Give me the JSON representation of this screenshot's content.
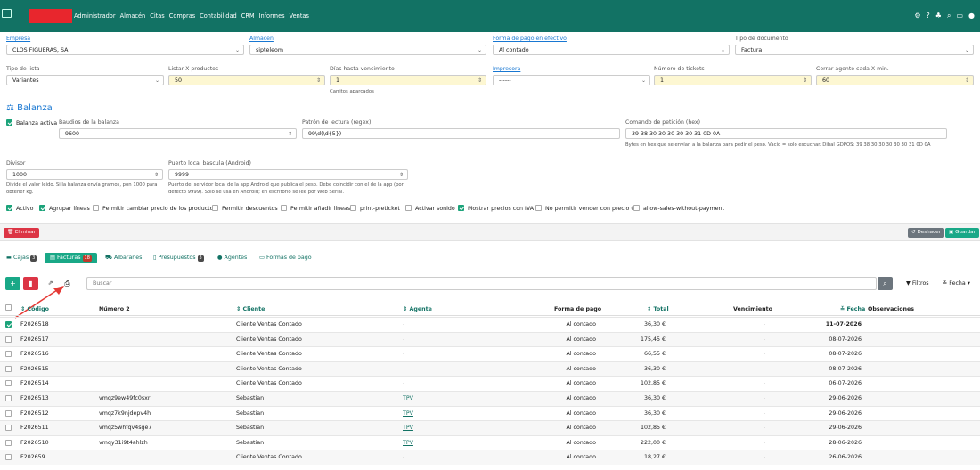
{
  "nav": {
    "menu": [
      "Administrador",
      "Almacén",
      "Citas",
      "Compras",
      "Contabilidad",
      "CRM",
      "Informes",
      "Ventas"
    ]
  },
  "form": {
    "empresa": {
      "label": "Empresa",
      "value": "CLOS FIGUERAS, SA"
    },
    "almacen": {
      "label": "Almacén",
      "value": "sipteleom"
    },
    "forma_pago": {
      "label": "Forma de pago en efectivo",
      "value": "Al contado"
    },
    "tipo_doc": {
      "label": "Tipo de documento",
      "value": "Factura"
    },
    "tipo_lista": {
      "label": "Tipo de lista",
      "value": "Variantes"
    },
    "listar": {
      "label": "Listar X productos",
      "value": "50"
    },
    "dias": {
      "label": "Días hasta vencimiento",
      "value": "1",
      "hint": "Carritos aparcados"
    },
    "impresora": {
      "label": "Impresora",
      "value": "------"
    },
    "tickets": {
      "label": "Número de tickets",
      "value": "1"
    },
    "cerrar": {
      "label": "Cerrar agente cada X min.",
      "value": "60"
    }
  },
  "balanza": {
    "title": "Balanza",
    "activa": "Balanza activa",
    "baudios": {
      "label": "Baudios de la balanza",
      "value": "9600"
    },
    "patron": {
      "label": "Patrón de lectura (regex)",
      "value": "99\\d(\\d{5})"
    },
    "comando": {
      "label": "Comando de petición (hex)",
      "value": "39 38 30 30 30 30 30 31 0D 0A",
      "hint": "Bytes en hex que se envían a la balanza para pedir el peso. Vacío = solo escuchar. Dibal GDPOS: 39 38 30 30 30 30 30 31 0D 0A"
    },
    "divisor": {
      "label": "Divisor",
      "value": "1000",
      "hint": "Divide el valor leído. Si la balanza envía gramos, pon 1000 para obtener kg."
    },
    "puerto": {
      "label": "Puerto local báscula (Android)",
      "value": "9999",
      "hint": "Puerto del servidor local de la app Android que publica el peso. Debe coincidir con el de la app (por defecto 9999). Solo se usa en Android; en escritorio se lee por Web Serial."
    }
  },
  "options": [
    {
      "label": "Activo",
      "on": true
    },
    {
      "label": "Agrupar líneas",
      "on": true
    },
    {
      "label": "Permitir cambiar precio de los productos",
      "on": false
    },
    {
      "label": "Permitir descuentos",
      "on": false
    },
    {
      "label": "Permitir añadir líneas",
      "on": false
    },
    {
      "label": "print-preticket",
      "on": false
    },
    {
      "label": "Activar sonido",
      "on": false
    },
    {
      "label": "Mostrar precios con IVA",
      "on": true
    },
    {
      "label": "No permitir vender con precio 0",
      "on": false
    },
    {
      "label": "allow-sales-without-payment",
      "on": false
    }
  ],
  "actions": {
    "eliminar": "Eliminar",
    "deshacer": "Deshacer",
    "guardar": "Guardar"
  },
  "tabs": [
    {
      "label": "Cajas",
      "badge": "3"
    },
    {
      "label": "Facturas",
      "badge": "18"
    },
    {
      "label": "Albaranes",
      "badge": ""
    },
    {
      "label": "Presupuestos",
      "badge": "3"
    },
    {
      "label": "Agentes",
      "badge": ""
    },
    {
      "label": "Formas de pago",
      "badge": ""
    }
  ],
  "toolbar": {
    "search_placeholder": "Buscar",
    "filtros": "Filtros",
    "fecha": "Fecha"
  },
  "table": {
    "headers": {
      "codigo": "Código",
      "numero2": "Número 2",
      "cliente": "Cliente",
      "agente": "Agente",
      "forma_pago": "Forma de pago",
      "total": "Total",
      "vencimiento": "Vencimiento",
      "fecha": "Fecha",
      "observaciones": "Observaciones"
    },
    "rows": [
      {
        "codigo": "F2026518",
        "numero2": "",
        "cliente": "Cliente Ventas Contado",
        "agente": "-",
        "forma": "Al contado",
        "total": "36,30 €",
        "venc": "-",
        "fecha": "11-07-2026",
        "checked": true,
        "bold": true
      },
      {
        "codigo": "F2026517",
        "numero2": "",
        "cliente": "Cliente Ventas Contado",
        "agente": "-",
        "forma": "Al contado",
        "total": "175,45 €",
        "venc": "-",
        "fecha": "08-07-2026"
      },
      {
        "codigo": "F2026516",
        "numero2": "",
        "cliente": "Cliente Ventas Contado",
        "agente": "-",
        "forma": "Al contado",
        "total": "66,55 €",
        "venc": "-",
        "fecha": "08-07-2026"
      },
      {
        "codigo": "F2026515",
        "numero2": "",
        "cliente": "Cliente Ventas Contado",
        "agente": "-",
        "forma": "Al contado",
        "total": "36,30 €",
        "venc": "-",
        "fecha": "08-07-2026"
      },
      {
        "codigo": "F2026514",
        "numero2": "",
        "cliente": "Cliente Ventas Contado",
        "agente": "-",
        "forma": "Al contado",
        "total": "102,85 €",
        "venc": "-",
        "fecha": "06-07-2026"
      },
      {
        "codigo": "F2026513",
        "numero2": "vmqz9ew49fc0sxr",
        "cliente": "Sebastian",
        "agente": "TPV",
        "forma": "Al contado",
        "total": "36,30 €",
        "venc": "-",
        "fecha": "29-06-2026"
      },
      {
        "codigo": "F2026512",
        "numero2": "vmqz7k9njdepv4h",
        "cliente": "Sebastian",
        "agente": "TPV",
        "forma": "Al contado",
        "total": "36,30 €",
        "venc": "-",
        "fecha": "29-06-2026"
      },
      {
        "codigo": "F2026511",
        "numero2": "vmqz5whfqv4sge7",
        "cliente": "Sebastian",
        "agente": "TPV",
        "forma": "Al contado",
        "total": "102,85 €",
        "venc": "-",
        "fecha": "29-06-2026"
      },
      {
        "codigo": "F2026510",
        "numero2": "vmqy31i9t4ahlzh",
        "cliente": "Sebastian",
        "agente": "TPV",
        "forma": "Al contado",
        "total": "222,00 €",
        "venc": "-",
        "fecha": "28-06-2026"
      },
      {
        "codigo": "F202659",
        "numero2": "",
        "cliente": "Cliente Ventas Contado",
        "agente": "-",
        "forma": "Al contado",
        "total": "18,27 €",
        "venc": "-",
        "fecha": "26-06-2026"
      }
    ]
  }
}
